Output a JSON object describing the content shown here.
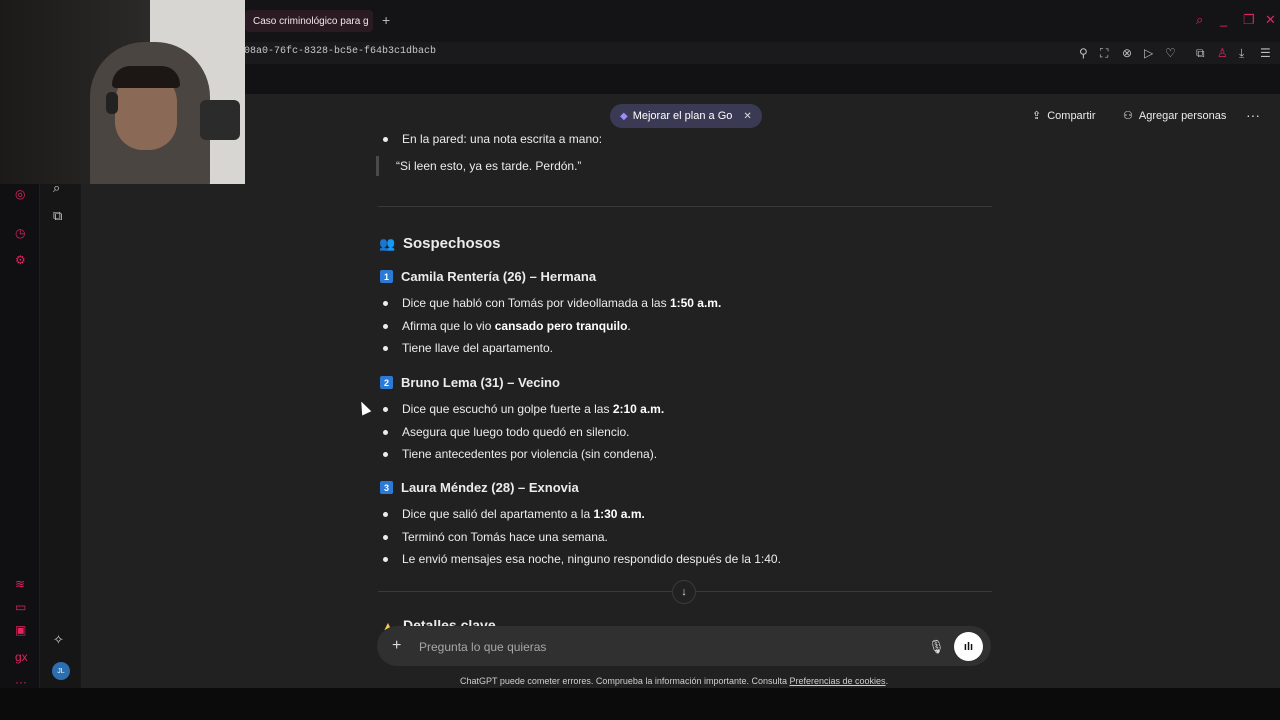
{
  "browser": {
    "tab_title": "Caso criminológico para g",
    "url": "08a0-76fc-8328-bc5e-f64b3c1dbacb"
  },
  "header": {
    "upgrade_label": "Mejorar el plan a Go",
    "share_label": "Compartir",
    "add_people_label": "Agregar personas"
  },
  "content": {
    "partial_item": "En la pared: una nota escrita a mano:",
    "quote": "“Si leen esto, ya es tarde. Perdón.”",
    "section_title": "Sospechosos",
    "suspects": [
      {
        "number": "1",
        "title": "Camila Rentería (26) – Hermana",
        "bullets": [
          {
            "pre": "Dice que habló con Tomás por videollamada a las ",
            "bold": "1:50 a.m.",
            "post": ""
          },
          {
            "pre": "Afirma que lo vio ",
            "bold": "cansado pero tranquilo",
            "post": "."
          },
          {
            "pre": "Tiene llave del apartamento.",
            "bold": "",
            "post": ""
          }
        ]
      },
      {
        "number": "2",
        "title": "Bruno Lema (31) – Vecino",
        "bullets": [
          {
            "pre": "Dice que escuchó un golpe fuerte a las ",
            "bold": "2:10 a.m.",
            "post": ""
          },
          {
            "pre": "Asegura que luego todo quedó en silencio.",
            "bold": "",
            "post": ""
          },
          {
            "pre": "Tiene antecedentes por violencia (sin condena).",
            "bold": "",
            "post": ""
          }
        ]
      },
      {
        "number": "3",
        "title": "Laura Méndez (28) – Exnovia",
        "bullets": [
          {
            "pre": "Dice que salió del apartamento a la ",
            "bold": "1:30 a.m.",
            "post": ""
          },
          {
            "pre": "Terminó con Tomás hace una semana.",
            "bold": "",
            "post": ""
          },
          {
            "pre": "Le envió mensajes esa noche, ninguno respondido después de la 1:40.",
            "bold": "",
            "post": ""
          }
        ]
      }
    ],
    "next_section_partial": "Detalles clave"
  },
  "composer": {
    "placeholder": "Pregunta lo que quieras"
  },
  "footer": {
    "disclaimer": "ChatGPT puede cometer errores. Comprueba la información importante. Consulta ",
    "link": "Preferencias de cookies",
    "end": "."
  },
  "sidebar": {
    "avatar_initials": "JL"
  },
  "colors": {
    "accent": "#e0245e",
    "number_badge": "#2b7bd6",
    "main_bg": "#212121"
  }
}
